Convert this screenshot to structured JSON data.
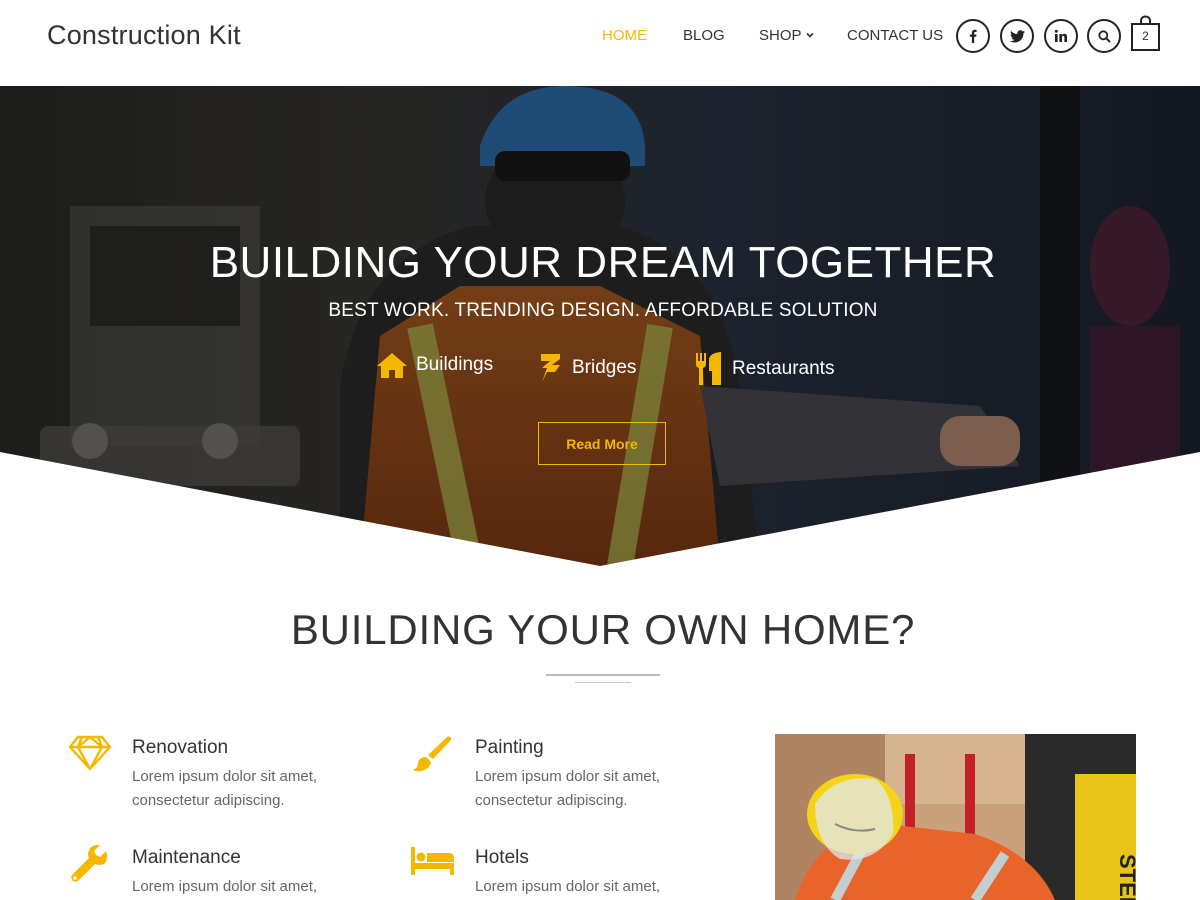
{
  "site": {
    "logo": "Construction Kit"
  },
  "nav": {
    "items": [
      {
        "label": "HOME",
        "active": true
      },
      {
        "label": "BLOG",
        "active": false
      },
      {
        "label": "SHOP",
        "active": false,
        "has_dropdown": true
      },
      {
        "label": "CONTACT US",
        "active": false
      }
    ],
    "social": [
      "facebook-icon",
      "twitter-icon",
      "linkedin-icon"
    ],
    "search_icon": "search-icon",
    "cart_count": "2"
  },
  "hero": {
    "title": "BUILDING YOUR DREAM TOGETHER",
    "subtitle": "BEST WORK. TRENDING DESIGN. AFFORDABLE SOLUTION",
    "features": [
      {
        "label": "Buildings",
        "icon": "home-icon"
      },
      {
        "label": "Bridges",
        "icon": "bridge-icon"
      },
      {
        "label": "Restaurants",
        "icon": "cutlery-icon"
      }
    ],
    "cta": "Read More"
  },
  "section": {
    "title": "BUILDING YOUR OWN HOME?",
    "services": [
      {
        "title": "Renovation",
        "desc": "Lorem ipsum dolor sit amet, consectetur adipiscing.",
        "icon": "diamond-icon"
      },
      {
        "title": "Painting",
        "desc": "Lorem ipsum dolor sit amet, consectetur adipiscing.",
        "icon": "paintbrush-icon"
      },
      {
        "title": "Maintenance",
        "desc": "Lorem ipsum dolor sit amet,",
        "icon": "wrench-icon"
      },
      {
        "title": "Hotels",
        "desc": "Lorem ipsum dolor sit amet,",
        "icon": "bed-icon"
      }
    ]
  },
  "colors": {
    "accent": "#f5b800",
    "text": "#333333",
    "muted": "#666666"
  }
}
